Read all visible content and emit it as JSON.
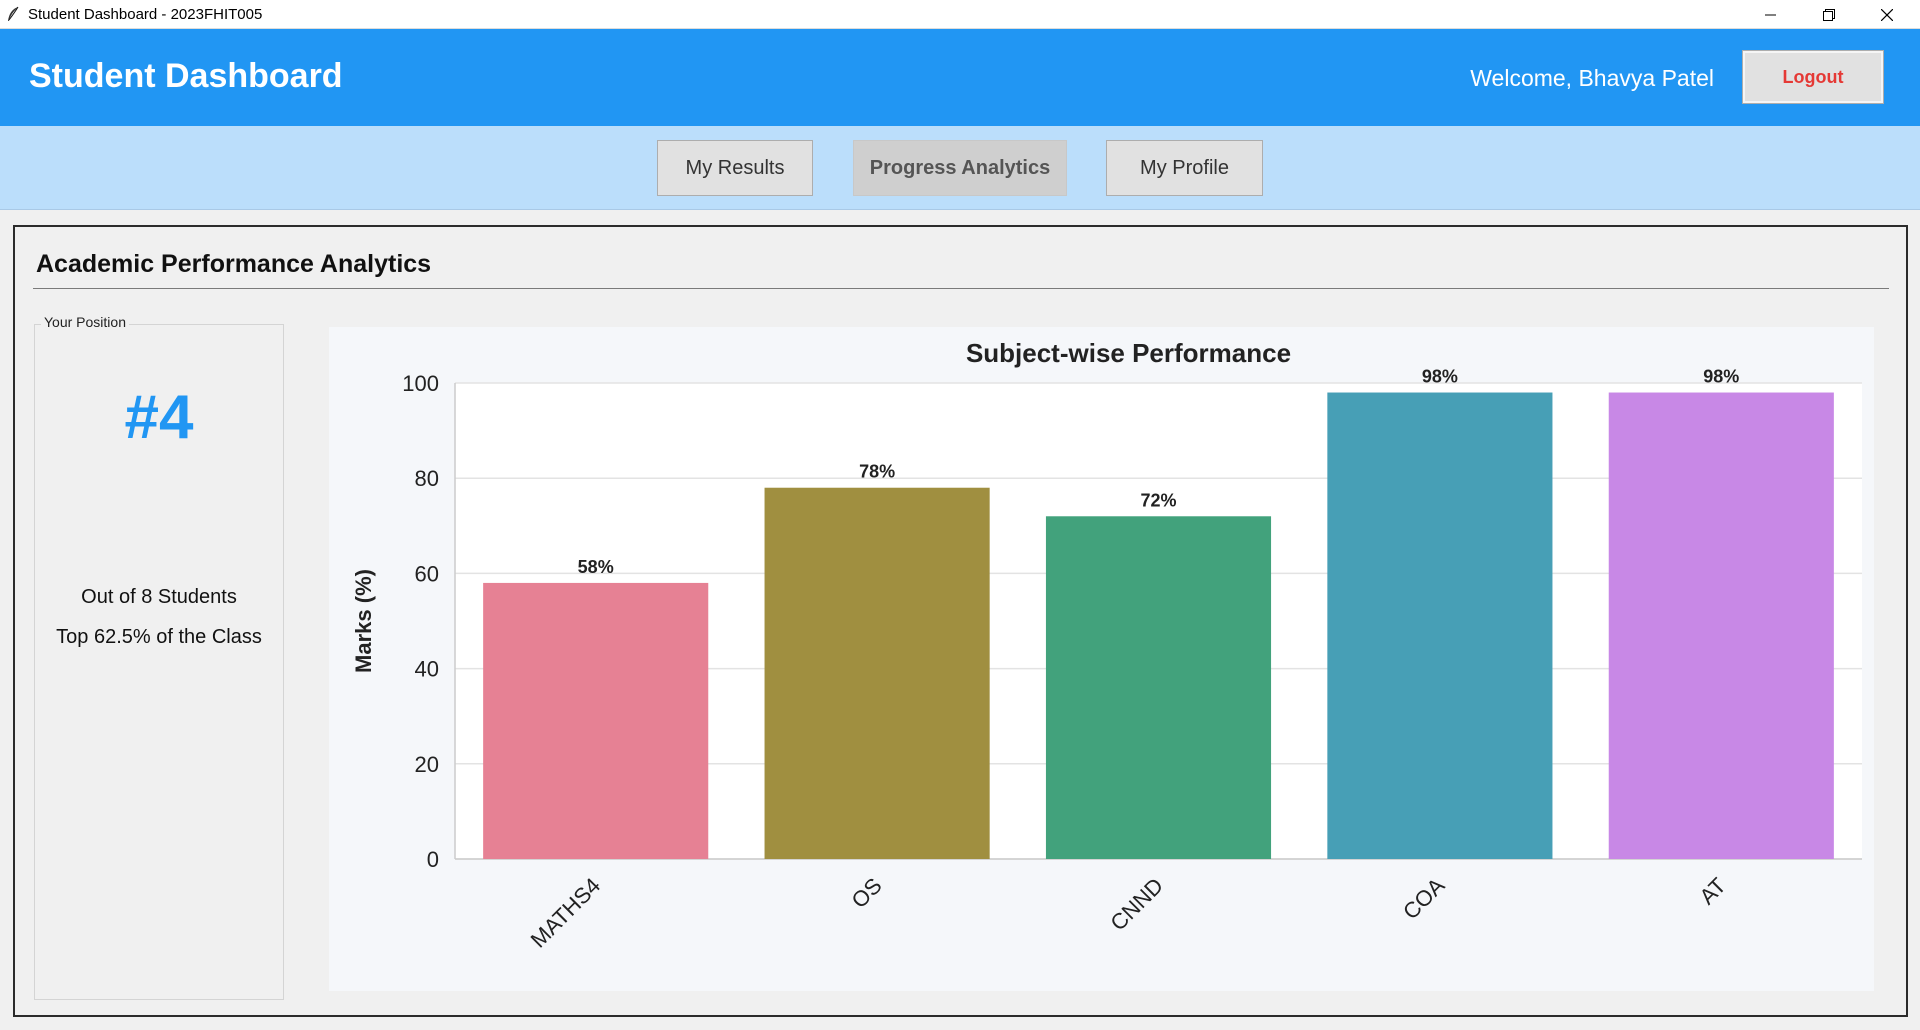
{
  "window": {
    "title": "Student Dashboard - 2023FHIT005"
  },
  "header": {
    "title": "Student Dashboard",
    "welcome": "Welcome, Bhavya Patel",
    "logout_label": "Logout"
  },
  "nav": {
    "tabs": [
      {
        "label": "My Results",
        "active": false
      },
      {
        "label": "Progress Analytics",
        "active": true
      },
      {
        "label": "My Profile",
        "active": false
      }
    ]
  },
  "main": {
    "section_title": "Academic Performance Analytics",
    "position": {
      "legend": "Your Position",
      "rank": "#4",
      "out_of": "Out of 8 Students",
      "top_percent": "Top 62.5% of the Class"
    }
  },
  "colors": {
    "header_bg": "#2196f3",
    "nav_bg": "#bbdefb",
    "logout_text": "#e53935",
    "rank_text": "#2196f3"
  },
  "chart_data": {
    "type": "bar",
    "title": "Subject-wise Performance",
    "xlabel": "",
    "ylabel": "Marks (%)",
    "ylim": [
      0,
      100
    ],
    "yticks": [
      0,
      20,
      40,
      60,
      80,
      100
    ],
    "grid": true,
    "categories": [
      "MATHS4",
      "OS",
      "CNND",
      "COA",
      "AT"
    ],
    "values": [
      58,
      78,
      72,
      98,
      98
    ],
    "data_labels": [
      "58%",
      "78%",
      "72%",
      "98%",
      "98%"
    ],
    "colors": [
      "#e68194",
      "#a08f40",
      "#42a27c",
      "#479fb6",
      "#c888e6"
    ]
  }
}
